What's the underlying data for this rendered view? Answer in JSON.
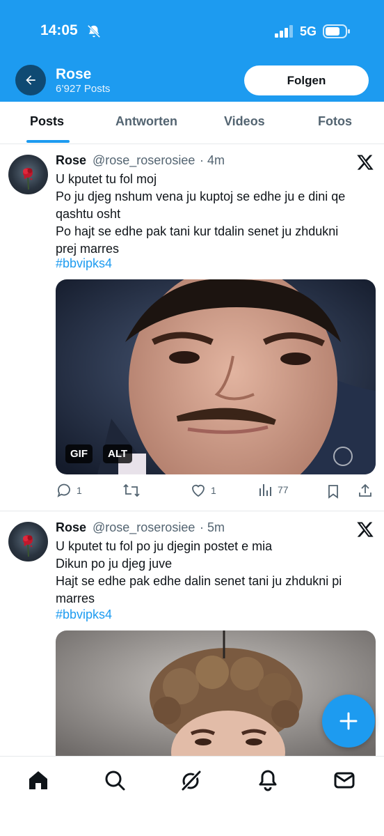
{
  "status_bar": {
    "time": "14:05",
    "network": "5G",
    "icons": [
      "bell-slash-icon",
      "signal-icon",
      "battery-icon"
    ]
  },
  "header": {
    "name": "Rose",
    "post_count": "6’927 Posts",
    "follow_label": "Folgen",
    "back_icon": "arrow-left-icon",
    "background": "#1d9bf0"
  },
  "tabs": [
    {
      "label": "Posts",
      "active": true
    },
    {
      "label": "Antworten",
      "active": false
    },
    {
      "label": "Videos",
      "active": false
    },
    {
      "label": "Fotos",
      "active": false
    }
  ],
  "posts": [
    {
      "name": "Rose",
      "handle": "@rose_roserosiee",
      "dot": "·",
      "time": "4m",
      "lines": [
        "U kputet tu fol moj",
        "Po ju djeg nshum vena ju kuptoj se edhe ju e dini qe",
        "qashtu osht",
        "Po hajt se edhe pak tani kur tdalin senet ju zhdukni",
        "prej marres"
      ],
      "hashtag": "#bbvipks4",
      "media_badges": [
        "GIF",
        "ALT"
      ],
      "stats": {
        "replies": "1",
        "reposts": "",
        "likes": "1",
        "views": "77"
      }
    },
    {
      "name": "Rose",
      "handle": "@rose_roserosiee",
      "dot": "·",
      "time": "5m",
      "lines": [
        "U kputet tu fol po ju djegin postet e mia",
        "Dikun po ju djeg juve",
        "Hajt se edhe pak edhe dalin senet tani ju zhdukni pi",
        "marres"
      ],
      "hashtag": "#bbvipks4"
    }
  ],
  "fab_icon": "plus-icon",
  "bottom_nav": [
    "home-icon",
    "search-icon",
    "grok-icon",
    "notifications-icon",
    "messages-icon"
  ],
  "colors": {
    "accent": "#1d9bf0",
    "text": "#0f1419",
    "muted": "#536471"
  }
}
